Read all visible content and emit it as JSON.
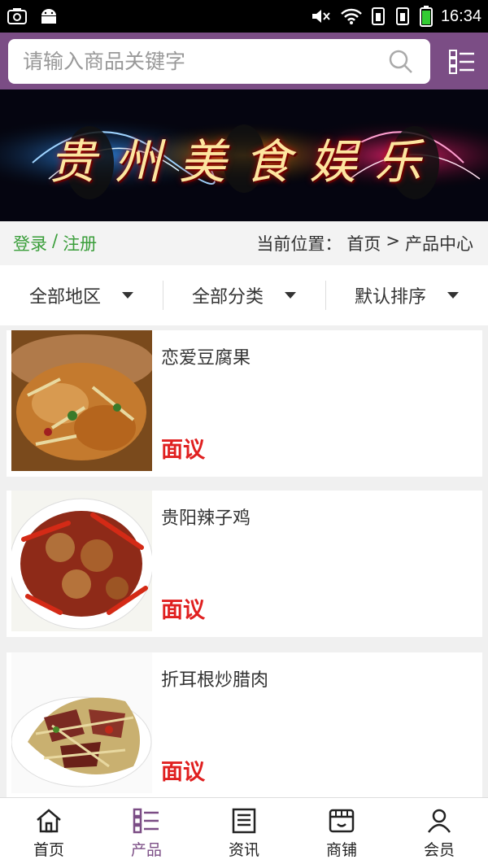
{
  "status_bar": {
    "time": "16:34"
  },
  "search": {
    "placeholder": "请输入商品关键字"
  },
  "banner": {
    "title": "贵州美食娱乐"
  },
  "breadcrumb": {
    "login": "登录",
    "separator": "/",
    "register": "注册",
    "location_label": "当前位置：",
    "home": "首页",
    "arrow": ">",
    "current": "产品中心"
  },
  "filters": [
    {
      "label": "全部地区"
    },
    {
      "label": "全部分类"
    },
    {
      "label": "默认排序"
    }
  ],
  "products": [
    {
      "name": "恋爱豆腐果",
      "price": "面议"
    },
    {
      "name": "贵阳辣子鸡",
      "price": "面议"
    },
    {
      "name": "折耳根炒腊肉",
      "price": "面议"
    }
  ],
  "bottom_nav": [
    {
      "label": "首页",
      "icon": "home-icon"
    },
    {
      "label": "产品",
      "icon": "grid-list-icon"
    },
    {
      "label": "资讯",
      "icon": "news-icon"
    },
    {
      "label": "商铺",
      "icon": "store-icon"
    },
    {
      "label": "会员",
      "icon": "user-icon"
    }
  ],
  "colors": {
    "brand": "#7b4d85",
    "price": "#e02020",
    "login": "#3a9e3a"
  }
}
